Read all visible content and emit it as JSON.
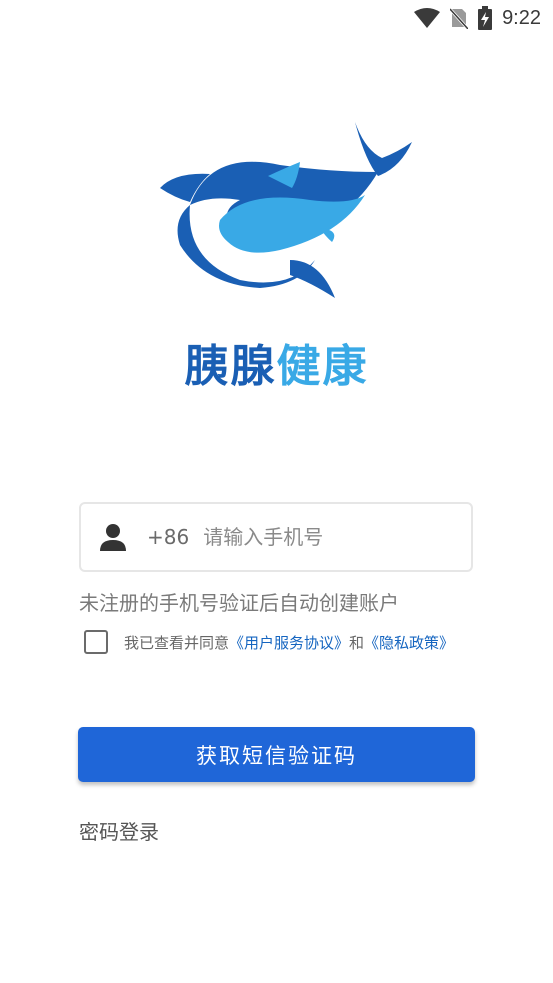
{
  "status_bar": {
    "time": "9:22"
  },
  "brand": {
    "name_part1": "胰腺",
    "name_part2": "健康",
    "colors": {
      "dark": "#1a5fb4",
      "light": "#39a9e6"
    }
  },
  "login": {
    "country_code": "+86",
    "phone_placeholder": "请输入手机号",
    "hint": "未注册的手机号验证后自动创建账户",
    "agree_prefix": "我已查看并同意",
    "user_agreement": "《用户服务协议》",
    "and": "和",
    "privacy_policy": "《隐私政策》",
    "sms_button": "获取短信验证码",
    "password_login": "密码登录"
  },
  "colors": {
    "primary": "#1f66d8",
    "link": "#1565c0"
  }
}
